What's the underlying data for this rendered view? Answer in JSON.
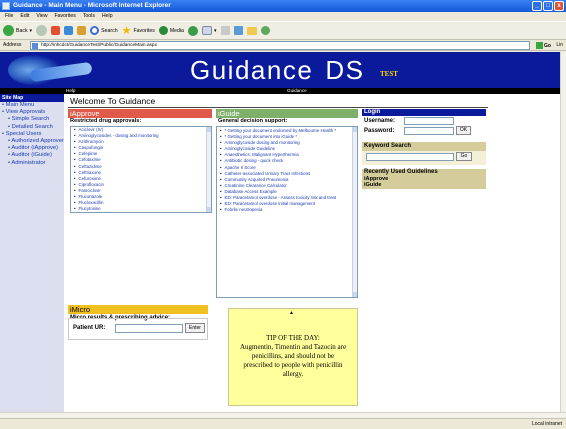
{
  "window": {
    "title": "Guidance - Main Menu - Microsoft Internet Explorer",
    "controls": [
      "_",
      "□",
      "x"
    ]
  },
  "menubar": [
    "File",
    "Edit",
    "View",
    "Favorites",
    "Tools",
    "Help"
  ],
  "toolbar": {
    "back": "Back",
    "search": "Search",
    "favorites": "Favorites",
    "media": "Media"
  },
  "address": {
    "label": "Address",
    "url": "http://inhcdct/GuidanceTest/Public/GuidanceMain.aspx",
    "go": "Go",
    "links": "Lin"
  },
  "header": {
    "brand_word": "Guidance",
    "brand_ds": "DS",
    "brand_tag": "TEST",
    "nav_help": "Help",
    "nav_guidance": "Guidance"
  },
  "sidebar": {
    "title": "Site Map",
    "items": [
      {
        "label": "Main Menu",
        "level": 1
      },
      {
        "label": "View Approvals",
        "level": 1
      },
      {
        "label": "Simple Search",
        "level": 2
      },
      {
        "label": "Detailed Search",
        "level": 2
      },
      {
        "label": "Special Users",
        "level": 1
      },
      {
        "label": "Authorized Approver",
        "level": 2
      },
      {
        "label": "Auditor (iApprove)",
        "level": 2
      },
      {
        "label": "Auditor (iGuide)",
        "level": 2
      },
      {
        "label": "Administrator",
        "level": 2
      }
    ]
  },
  "welcome": "Welcome To Guidance",
  "iapprove": {
    "title": "iApprove",
    "subtitle": "Restricted drug approvals:",
    "color": "#e05a4a",
    "items": [
      "Aciclovir (IV)",
      "Aminoglycosides - dosing and monitoring",
      "Azithromycin",
      "Caspofungin",
      "Cefepime",
      "Cefotaxime",
      "Ceftazidime",
      "Ceftriaxone",
      "Cefuroxime",
      "Ciprofloxacin",
      "Famciclovir",
      "Fluconazole",
      "Flucloxacillin",
      "Flucytosine"
    ]
  },
  "iguide": {
    "title": "iGuide",
    "subtitle": "General decision support:",
    "color": "#7fb06a",
    "items": [
      "* Getting your document endorsed by Melbourne Health *",
      "* Getting your document into iGuide *",
      "Aminoglycoside dosing and monitoring",
      "Aminoglycoside Guideline",
      "Anaesthetics: Malignant Hyperthermia",
      "Antibiotic dosing - quick check",
      "Apache II Score",
      "Catheter-associated Urinary Tract Infections",
      "Community Acquired Pneumonia",
      "Creatinine Clearance Calculator",
      "Database Access Example",
      "ED: Paracetamol overdose - Assess toxicity risk and treat",
      "ED: Paracetamol overdose initial management",
      "Febrile neutropenia"
    ]
  },
  "login": {
    "title": "Login",
    "username_label": "Username:",
    "password_label": "Password:",
    "ok": "OK",
    "keyword_title": "Keyword Search",
    "go": "Go",
    "recent_title": "Recently Used Guidelines",
    "recent_items": [
      "iApprove",
      "iGuide"
    ]
  },
  "imicro": {
    "title": "iMicro",
    "subtitle": "Micro results & prescribing advice:",
    "patient_label": "Patient UR:",
    "enter": "Enter",
    "color": "#f0c020"
  },
  "tip": {
    "title": "TIP OF THE DAY:",
    "text": "Augmentin, Timentin and Tazocin are penicillins, and should not be prescribed to people with penicillin allergy."
  },
  "status": {
    "zone": "Local intranet"
  }
}
